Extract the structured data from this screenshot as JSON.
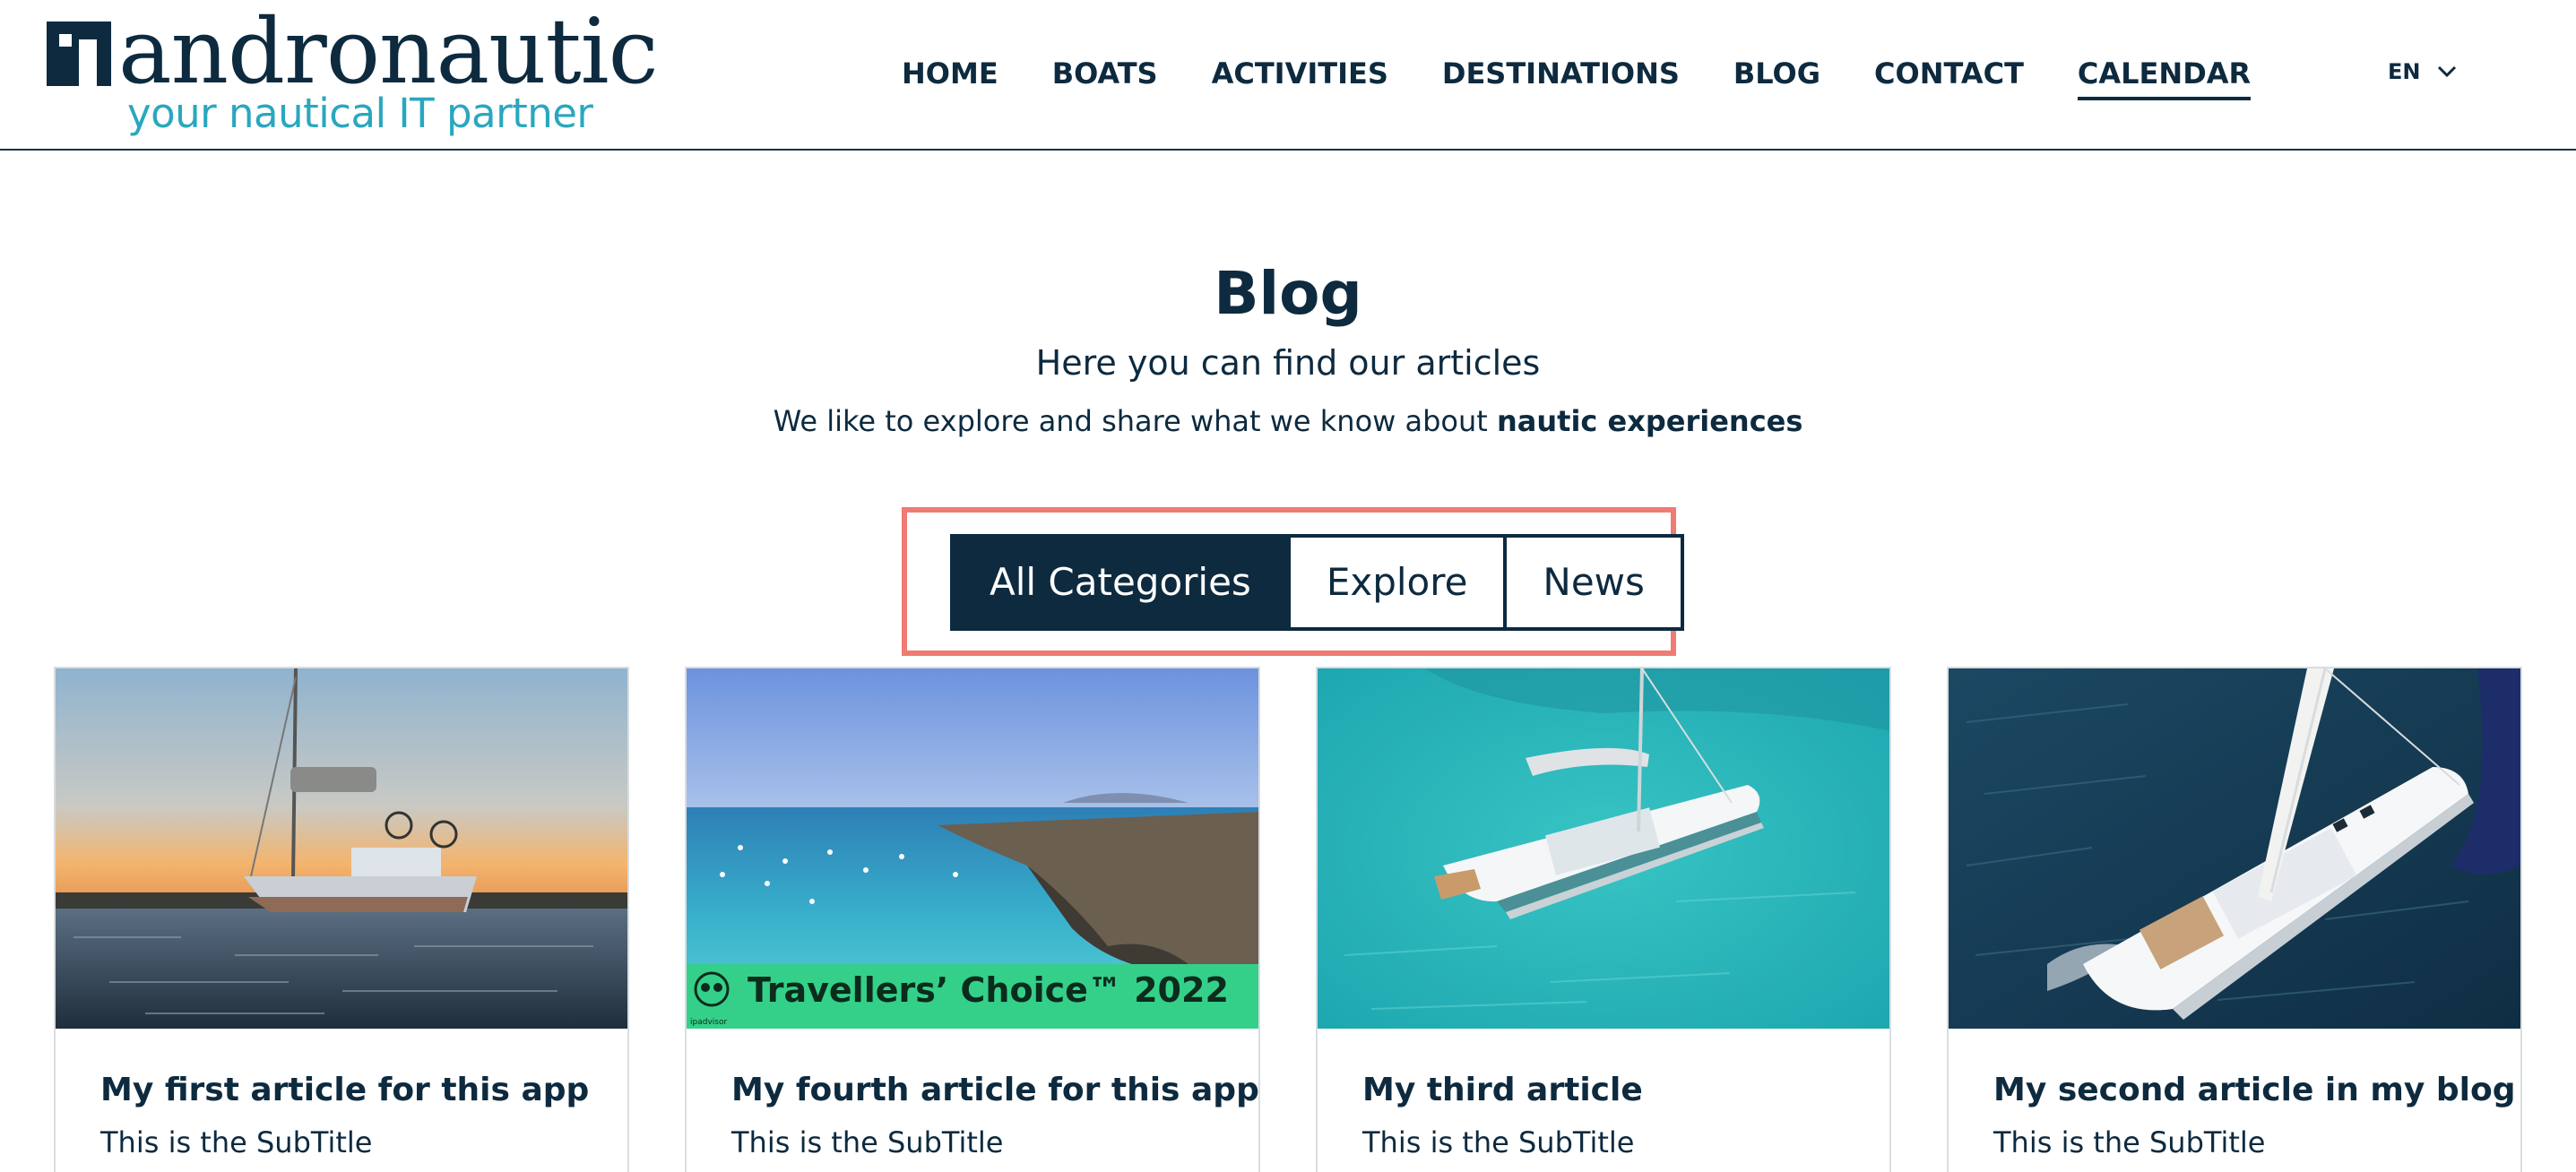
{
  "brand": {
    "name": "andronautic",
    "tagline": "your nautical IT partner"
  },
  "nav": {
    "items": [
      {
        "label": "HOME"
      },
      {
        "label": "BOATS"
      },
      {
        "label": "ACTIVITIES"
      },
      {
        "label": "DESTINATIONS"
      },
      {
        "label": "BLOG"
      },
      {
        "label": "CONTACT"
      },
      {
        "label": "CALENDAR"
      }
    ],
    "active": "CALENDAR"
  },
  "language": {
    "selected": "EN",
    "icon": "chevron-down-icon"
  },
  "hero": {
    "title": "Blog",
    "subtitle": "Here you can find our articles",
    "description_prefix": "We like to explore and share what we know about ",
    "description_bold": "nautic experiences"
  },
  "filters": {
    "options": [
      {
        "label": "All Categories"
      },
      {
        "label": "Explore"
      },
      {
        "label": "News"
      }
    ],
    "selected": "All Categories"
  },
  "articles": [
    {
      "title": "My first article for this app",
      "subtitle": "This is the SubTitle",
      "image": "sailboat-sunset-image"
    },
    {
      "title": "My fourth article for this app",
      "subtitle": "This is the SubTitle",
      "image": "coastal-bay-image",
      "badge": "Travellers’ Choice™ 2022",
      "badge_small": "ipadvisor"
    },
    {
      "title": "My third article",
      "subtitle": "This is the SubTitle",
      "image": "catamaran-turquoise-image"
    },
    {
      "title": "My second article in my blog",
      "subtitle": "This is the SubTitle",
      "image": "sailboat-aerial-image"
    }
  ],
  "colors": {
    "primary": "#0d2a3f",
    "accent": "#2aa7bf",
    "highlight": "#ef7b74",
    "badge_green": "#34d08a"
  }
}
